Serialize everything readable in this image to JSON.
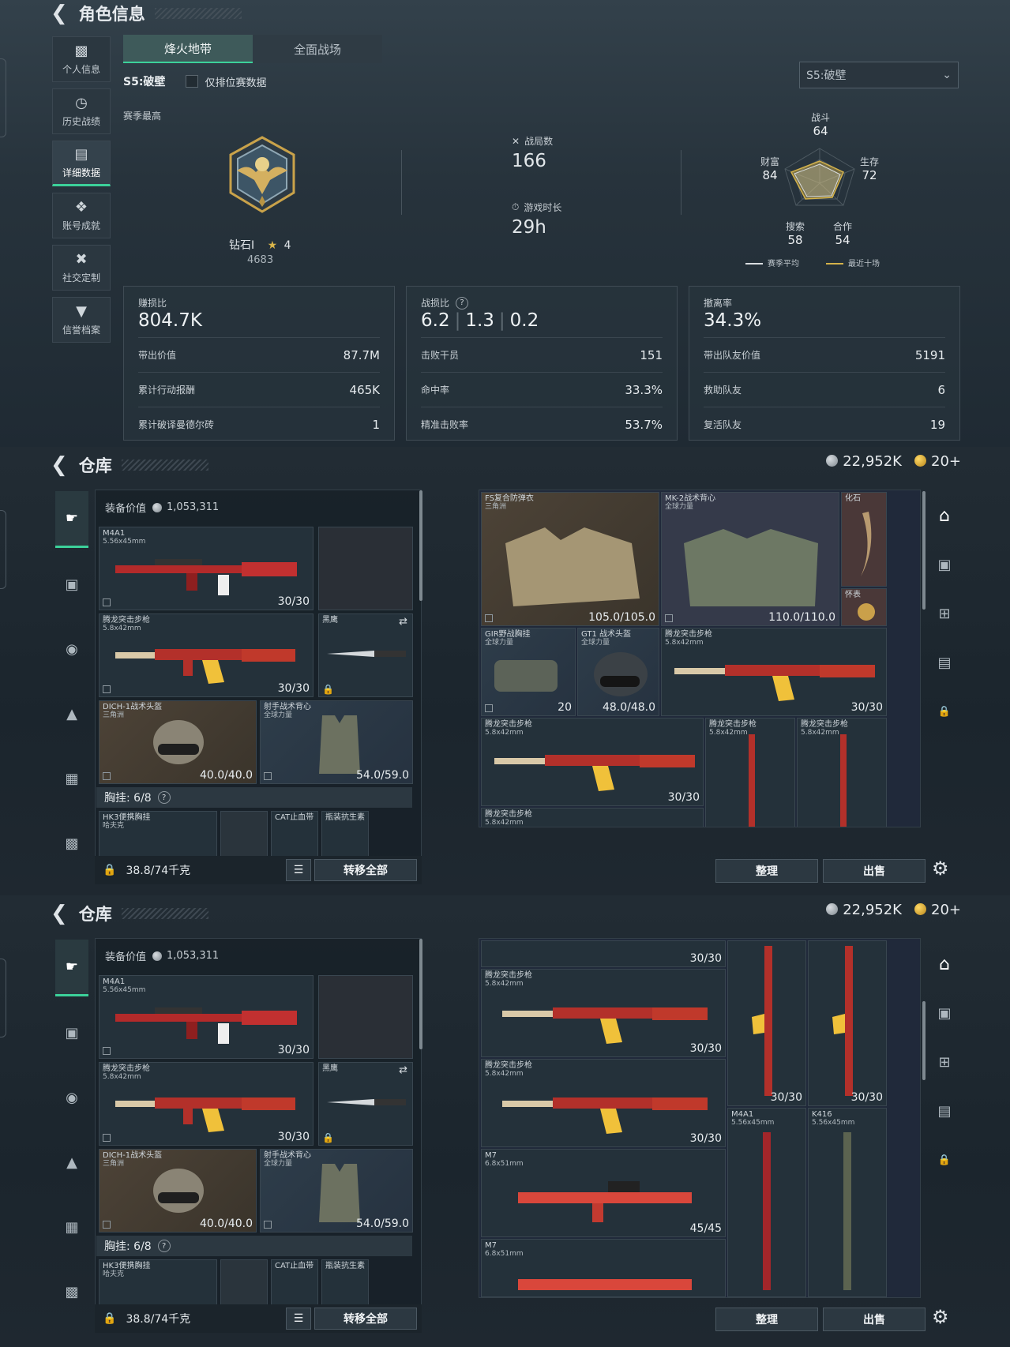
{
  "profile": {
    "header_title": "角色信息",
    "sidebar": [
      {
        "label": "个人信息",
        "icon": "bar-chart-icon"
      },
      {
        "label": "历史战绩",
        "icon": "clock-icon"
      },
      {
        "label": "详细数据",
        "icon": "folder-icon"
      },
      {
        "label": "账号成就",
        "icon": "medal-icon"
      },
      {
        "label": "社交定制",
        "icon": "tools-icon"
      },
      {
        "label": "信誉档案",
        "icon": "shield-icon"
      }
    ],
    "tabs": [
      "烽火地带",
      "全面战场"
    ],
    "season_label": "S5:破壁",
    "ranked_only_label": "仅排位赛数据",
    "season_dropdown": "S5:破壁",
    "season_best_label": "赛季最高",
    "rank_name": "钻石I",
    "rank_stars": "4",
    "rank_points": "4683",
    "matches_label": "战局数",
    "matches_value": "166",
    "playtime_label": "游戏时长",
    "playtime_value": "29h",
    "radar": {
      "labels": {
        "combat": "战斗",
        "survival": "生存",
        "cooperation": "合作",
        "search": "搜索",
        "wealth": "财富"
      },
      "values": {
        "combat": "64",
        "survival": "72",
        "cooperation": "54",
        "search": "58",
        "wealth": "84"
      },
      "legend_avg": "赛季平均",
      "legend_recent": "最近十场",
      "avg_color": "#d9dde0",
      "recent_color": "#d4b24a"
    },
    "cards": [
      {
        "head": "赚损比",
        "big": "804.7K",
        "rows": [
          {
            "k": "带出价值",
            "v": "87.7M"
          },
          {
            "k": "累计行动报酬",
            "v": "465K"
          },
          {
            "k": "累计破译曼德尔砖",
            "v": "1"
          }
        ]
      },
      {
        "head": "战损比",
        "big_a": "6.2",
        "big_b": "1.3",
        "big_c": "0.2",
        "rows": [
          {
            "k": "击败干员",
            "v": "151"
          },
          {
            "k": "命中率",
            "v": "33.3%"
          },
          {
            "k": "精准击败率",
            "v": "53.7%"
          }
        ]
      },
      {
        "head": "撤离率",
        "big": "34.3%",
        "rows": [
          {
            "k": "带出队友价值",
            "v": "5191"
          },
          {
            "k": "救助队友",
            "v": "6"
          },
          {
            "k": "复活队友",
            "v": "19"
          }
        ]
      }
    ]
  },
  "warehouse": {
    "title": "仓库",
    "money": "22,952K",
    "coupons": "20+",
    "equip_value_label": "装备价值",
    "equip_value": "1,053,311",
    "left_slots": {
      "primary": {
        "name": "M4A1",
        "ammo": "5.56x45mm",
        "count": "30/30"
      },
      "secondary": {
        "name": "腾龙突击步枪",
        "ammo": "5.8x42mm",
        "count": "30/30"
      },
      "melee": {
        "name": "黑鹰"
      },
      "helmet": {
        "name": "DICH-1战术头盔",
        "sub": "三角洲",
        "dur": "40.0/40.0"
      },
      "armor": {
        "name": "射手战术背心",
        "sub": "全球力量",
        "dur": "54.0/59.0"
      }
    },
    "rig_label": "胸挂: 6/8",
    "rig_items": [
      {
        "name": "HK3便携胸挂",
        "sub": "哈夫克"
      },
      {
        "name": "CAT止血带"
      },
      {
        "name": "瓶装抗生素"
      }
    ],
    "weight": "38.8/74千克",
    "transfer_all": "转移全部",
    "sort": "整理",
    "sell": "出售",
    "grid1": {
      "armor_fs": {
        "name": "FS复合防弹衣",
        "sub": "三角洲",
        "dur": "105.0/105.0"
      },
      "armor_mk2": {
        "name": "MK-2战术背心",
        "sub": "全球力量",
        "dur": "110.0/110.0"
      },
      "fossil": "化石",
      "watch": "怀表",
      "bag_gir": {
        "name": "GIR野战胸挂",
        "sub": "全球力量",
        "count": "20"
      },
      "helmet_gt1": {
        "name": "GT1 战术头盔",
        "sub": "全球力量",
        "dur": "48.0/48.0"
      },
      "rifle_a": {
        "name": "腾龙突击步枪",
        "ammo": "5.8x42mm",
        "count": "30/30"
      },
      "rifle_b": {
        "name": "腾龙突击步枪",
        "ammo": "5.8x42mm",
        "count": "30/30"
      },
      "rifle_c": {
        "name": "腾龙突击步枪",
        "ammo": "5.8x42mm"
      },
      "rifle_d": {
        "name": "腾龙突击步枪",
        "ammo": "5.8x42mm"
      },
      "rifle_e": {
        "name": "腾龙突击步枪",
        "ammo": "5.8x42mm"
      }
    },
    "grid2": {
      "top_count": "30/30",
      "rifle_a": {
        "name": "腾龙突击步枪",
        "ammo": "5.8x42mm",
        "count": "30/30"
      },
      "rifle_b": {
        "name": "腾龙突击步枪",
        "ammo": "5.8x42mm",
        "count": "30/30"
      },
      "vert_a_count": "30/30",
      "vert_b_count": "30/30",
      "m4a1": {
        "name": "M4A1",
        "ammo": "5.56x45mm"
      },
      "k416": {
        "name": "K416",
        "ammo": "5.56x45mm"
      },
      "m7a": {
        "name": "M7",
        "ammo": "6.8x51mm",
        "count": "45/45"
      },
      "m7b": {
        "name": "M7",
        "ammo": "6.8x51mm"
      }
    }
  }
}
